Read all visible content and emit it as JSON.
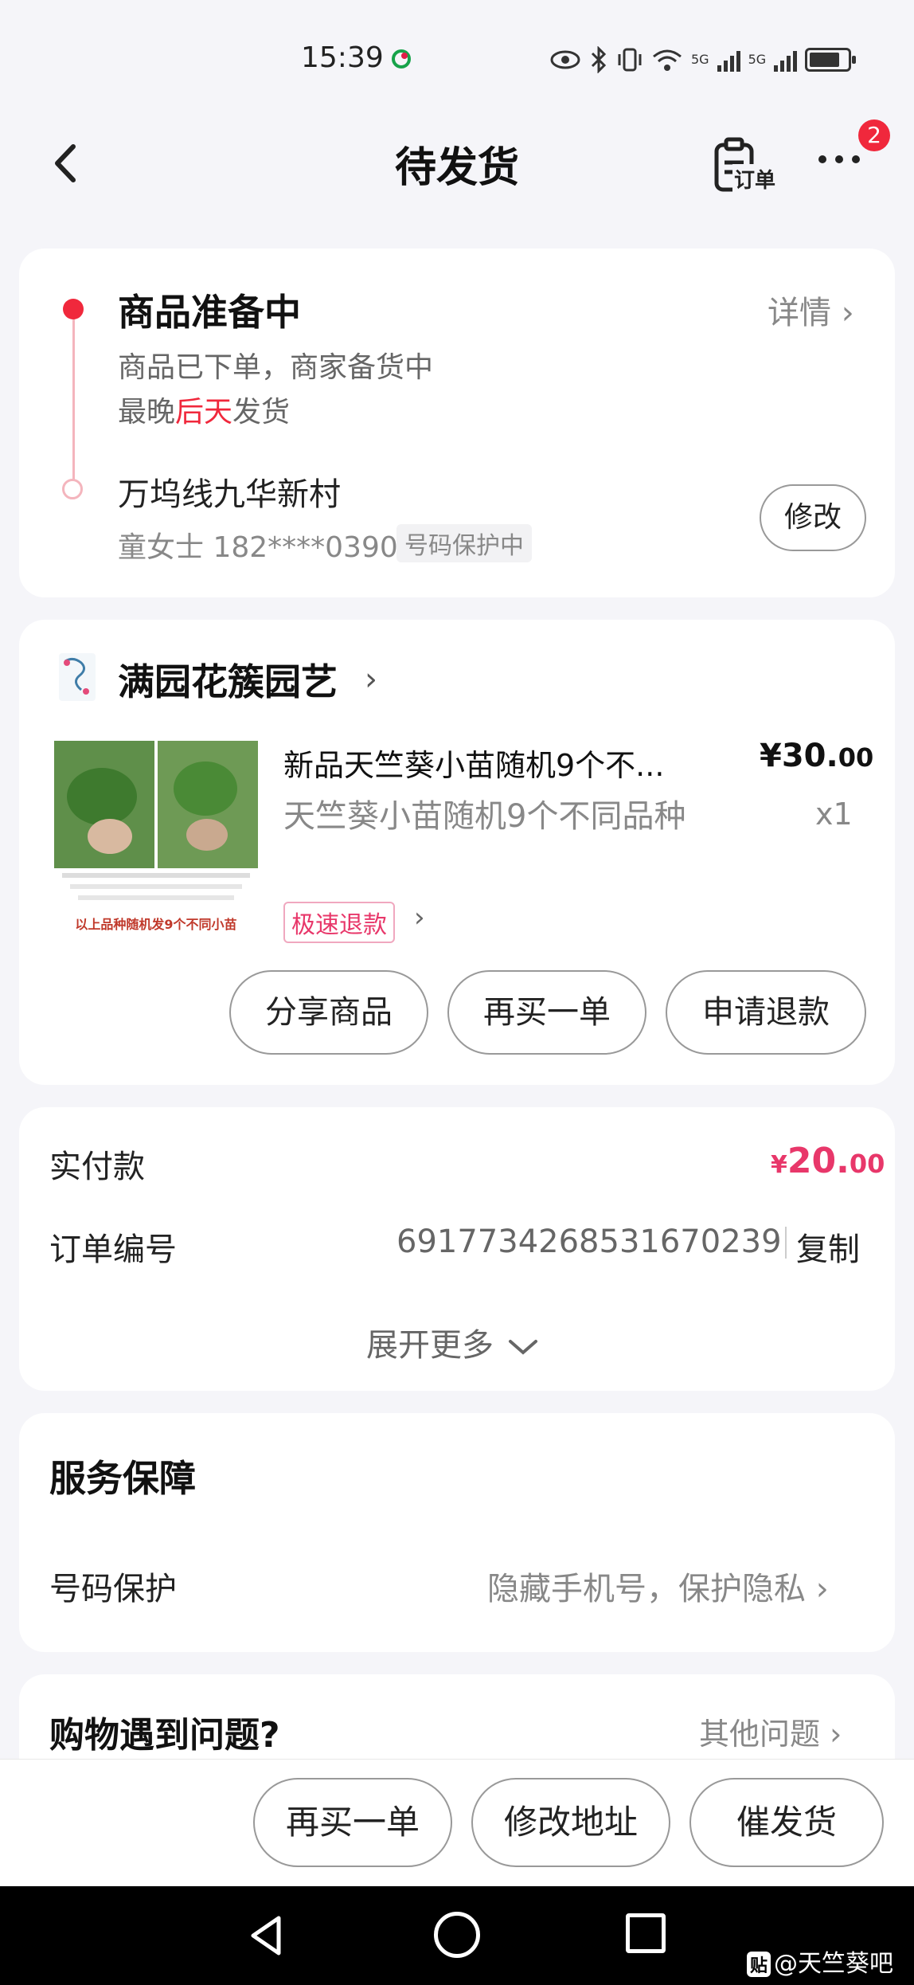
{
  "status_bar": {
    "time": "15:39",
    "network_labels": [
      "5G",
      "5G"
    ]
  },
  "header": {
    "title": "待发货",
    "order_label": "订单",
    "badge_count": "2"
  },
  "shipping": {
    "status_title": "商品准备中",
    "detail_link": "详情",
    "description": "商品已下单，商家备货中",
    "ship_prefix": "最晚",
    "ship_highlight": "后天",
    "ship_suffix": "发货",
    "address": "万坞线九华新村",
    "contact": "童女士 182****0390",
    "protect_tag": "号码保护中",
    "modify_label": "修改"
  },
  "shop": {
    "name": "满园花簇园艺",
    "product": {
      "name": "新品天竺葵小苗随机9个不...",
      "price_int": "¥30.",
      "price_dec": "00",
      "spec": "天竺葵小苗随机9个不同品种",
      "quantity": "x1",
      "fast_refund_tag": "极速退款",
      "image_caption": "以上品种随机发9个不同小苗"
    },
    "actions": [
      "分享商品",
      "再买一单",
      "申请退款"
    ]
  },
  "payment": {
    "paid_label": "实付款",
    "paid_currency": "¥",
    "paid_int": "20.",
    "paid_dec": "00",
    "order_no_label": "订单编号",
    "order_no": "6917734268531670239",
    "copy_label": "复制",
    "expand_label": "展开更多"
  },
  "service": {
    "title": "服务保障",
    "row_label": "号码保护",
    "row_value": "隐藏手机号，保护隐私"
  },
  "issues": {
    "title": "购物遇到问题?",
    "other_link": "其他问题"
  },
  "bottom_actions": [
    "再买一单",
    "修改地址",
    "催发货"
  ],
  "watermark": "@天竺葵吧",
  "colors": {
    "accent_red": "#f0283c",
    "price_pink": "#e8376a",
    "background": "#f5f5f9"
  }
}
